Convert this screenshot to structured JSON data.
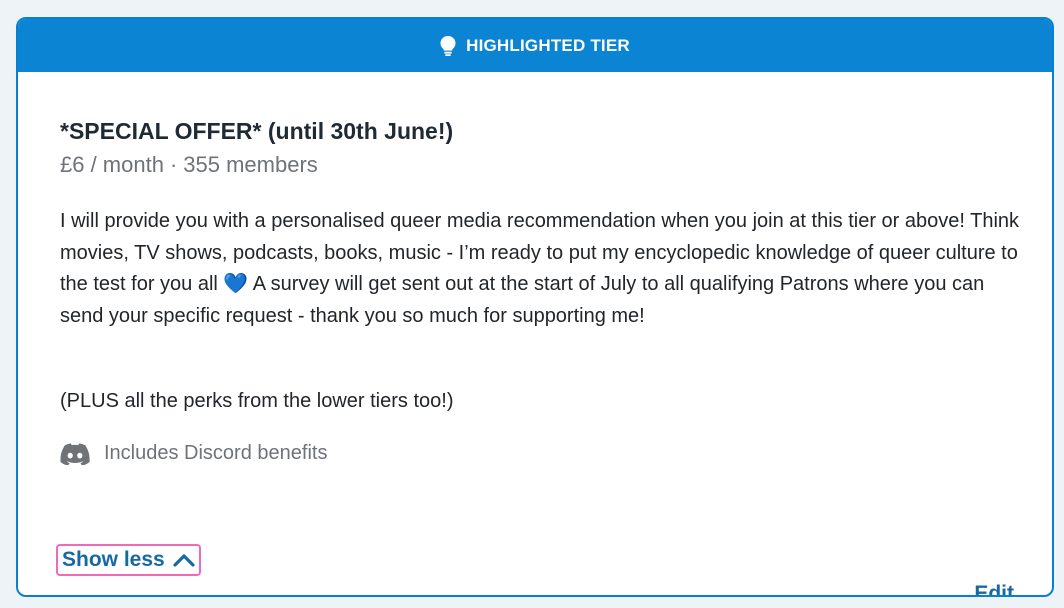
{
  "header": {
    "label": "HIGHLIGHTED TIER",
    "icon": "lightbulb-icon"
  },
  "tier": {
    "title": "*SPECIAL OFFER* (until 30th June!)",
    "price": "£6 / month",
    "separator": "·",
    "members": "355 members",
    "description_before_emoji": "I will provide you with a personalised queer media recommendation when you join at this tier or above! Think movies, TV shows, podcasts, books, music - I’m ready to put my encyclopedic knowledge of queer culture to the test for you all ",
    "emoji": "💙",
    "description_after_emoji": " A survey will get sent out at the start of July to all qualifying Patrons where you can send your specific request - thank you so much for supporting me!",
    "extra": "(PLUS all the perks from the lower tiers too!)",
    "discord": {
      "icon": "discord-icon",
      "label": "Includes Discord benefits"
    }
  },
  "actions": {
    "show_less_label": "Show less",
    "show_less_icon": "chevron-up-icon",
    "edit_label": "Edit"
  },
  "colors": {
    "accent": "#0a84d3",
    "link": "#1669a3",
    "focus_ring": "#f06ab8"
  }
}
